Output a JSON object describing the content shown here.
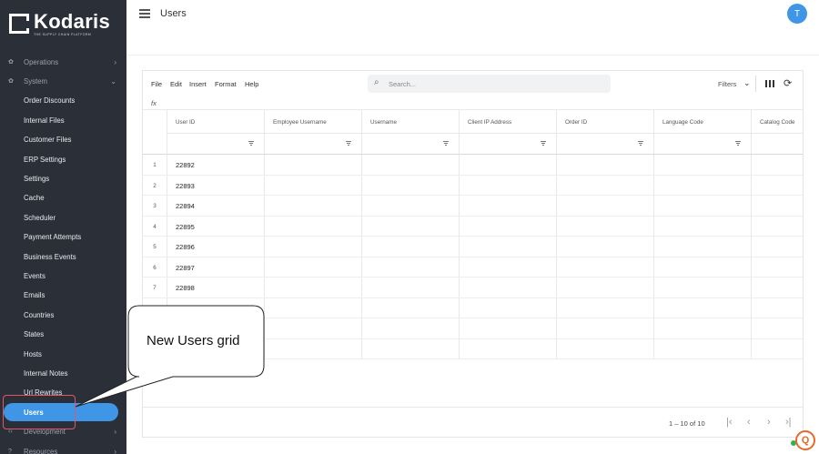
{
  "brand": {
    "name": "Kodaris",
    "tagline": "THE SUPPLY CHAIN PLATFORM"
  },
  "page": {
    "title": "Users"
  },
  "user": {
    "initial": "T"
  },
  "sidebar": {
    "items": [
      {
        "label": "Operations",
        "icon": "gear-icon",
        "parent": true,
        "chevron": "›"
      },
      {
        "label": "System",
        "icon": "gear-icon",
        "parent": true,
        "chevron": "⌄"
      },
      {
        "label": "Order Discounts"
      },
      {
        "label": "Internal Files"
      },
      {
        "label": "Customer Files"
      },
      {
        "label": "ERP Settings"
      },
      {
        "label": "Settings"
      },
      {
        "label": "Cache"
      },
      {
        "label": "Scheduler"
      },
      {
        "label": "Payment Attempts"
      },
      {
        "label": "Business Events"
      },
      {
        "label": "Events"
      },
      {
        "label": "Emails"
      },
      {
        "label": "Countries"
      },
      {
        "label": "States"
      },
      {
        "label": "Hosts"
      },
      {
        "label": "Internal Notes"
      },
      {
        "label": "Url Rewrites"
      },
      {
        "label": "Users",
        "active": true
      },
      {
        "label": "Development",
        "icon": "code-icon",
        "parent": true,
        "chevron": "›"
      },
      {
        "label": "Resources",
        "icon": "help-icon",
        "parent": true,
        "chevron": "›"
      }
    ]
  },
  "toolbar": {
    "menus": [
      "File",
      "Edit",
      "Insert",
      "Format",
      "Help"
    ],
    "search_placeholder": "Search...",
    "filters_label": "Filters",
    "fx_label": "fx"
  },
  "grid": {
    "columns": [
      "User ID",
      "Employee Username",
      "Username",
      "Client IP Address",
      "Order ID",
      "Language Code",
      "Catalog Code"
    ],
    "rows": [
      {
        "num": "1",
        "user_id": "22892"
      },
      {
        "num": "2",
        "user_id": "22893"
      },
      {
        "num": "3",
        "user_id": "22894"
      },
      {
        "num": "4",
        "user_id": "22895"
      },
      {
        "num": "5",
        "user_id": "22896"
      },
      {
        "num": "6",
        "user_id": "22897"
      },
      {
        "num": "7",
        "user_id": "22898"
      },
      {
        "num": "",
        "user_id": ""
      },
      {
        "num": "",
        "user_id": ""
      },
      {
        "num": "",
        "user_id": ""
      }
    ]
  },
  "pagination": {
    "range_text": "1 – 10 of 10"
  },
  "callout": {
    "text": "New Users grid",
    "color": "#e0566b"
  },
  "colors": {
    "sidebar_bg": "#2b2f38",
    "accent": "#3f96e6",
    "help": "#e8692a"
  }
}
